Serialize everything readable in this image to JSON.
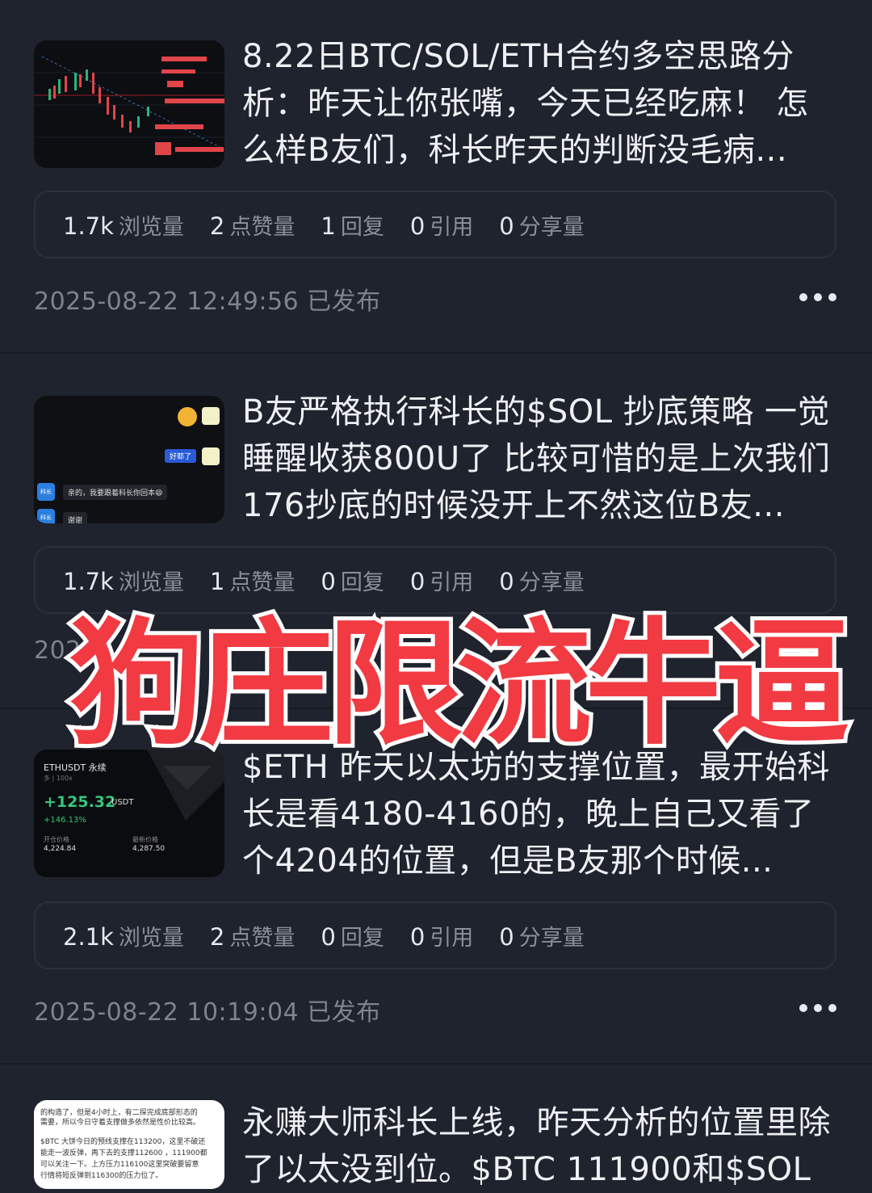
{
  "posts": [
    {
      "title": "8.22日BTC/SOL/ETH合约多空思路分析：昨天让你张嘴，今天已经吃麻！ 怎么样B友们，科长昨天的判断没毛病...",
      "stats": [
        {
          "n": "1.7k",
          "l": "浏览量"
        },
        {
          "n": "2",
          "l": "点赞量"
        },
        {
          "n": "1",
          "l": "回复"
        },
        {
          "n": "0",
          "l": "引用"
        },
        {
          "n": "0",
          "l": "分享量"
        }
      ],
      "time": "2025-08-22 12:49:56 已发布"
    },
    {
      "title": "B友严格执行科长的$SOL 抄底策略 一觉睡醒收获800U了 比较可惜的是上次我们176抄底的时候没开上不然这位B友...",
      "stats": [
        {
          "n": "1.7k",
          "l": "浏览量"
        },
        {
          "n": "1",
          "l": "点赞量"
        },
        {
          "n": "0",
          "l": "回复"
        },
        {
          "n": "0",
          "l": "引用"
        },
        {
          "n": "0",
          "l": "分享量"
        }
      ],
      "time": "2025"
    },
    {
      "title": "$ETH 昨天以太坊的支撑位置，最开始科长是看4180-4160的，晚上自己又看了个4204的位置，但是B友那个时候...",
      "stats": [
        {
          "n": "2.1k",
          "l": "浏览量"
        },
        {
          "n": "2",
          "l": "点赞量"
        },
        {
          "n": "0",
          "l": "回复"
        },
        {
          "n": "0",
          "l": "引用"
        },
        {
          "n": "0",
          "l": "分享量"
        }
      ],
      "time": "2025-08-22 10:19:04 已发布"
    },
    {
      "title": "永赚大师科长上线，昨天分析的位置里除了以太没到位。$BTC 111900和$SOL"
    }
  ],
  "overlay_text": "狗庄限流牛逼",
  "thumb2": {
    "bubble1": "好耶了",
    "bubble2": "亲的，我要跟着科长你回本😄",
    "bubble3": "谢谢",
    "tag": "科长"
  },
  "thumb3": {
    "pair": "ETHUSDT 永续",
    "sub": "多 | 100x",
    "pnl": "+125.32",
    "unit": "USDT",
    "pct": "+146.13%",
    "open_label": "开仓价格",
    "open_val": "4,224.84",
    "last_label": "最新价格",
    "last_val": "4,287.50"
  },
  "thumb4": {
    "lines": [
      "的构造了，但是4小时上，有二探完成底部形态的",
      "需要，所以今日守着支撑做多依然是性价比较高。",
      "$BTC 大饼今日的预线支撑在113200，这里不破还",
      "能走一波反弹，再下去的支撑112600 ，111900都",
      "可以关注一下。上方压力116100这里突破要留意",
      "行情将短反弹到116300的压力位了。"
    ]
  },
  "colors": {
    "bg": "#1f232d",
    "overlay_red": "#f23a42",
    "up_green": "#36c77c"
  }
}
